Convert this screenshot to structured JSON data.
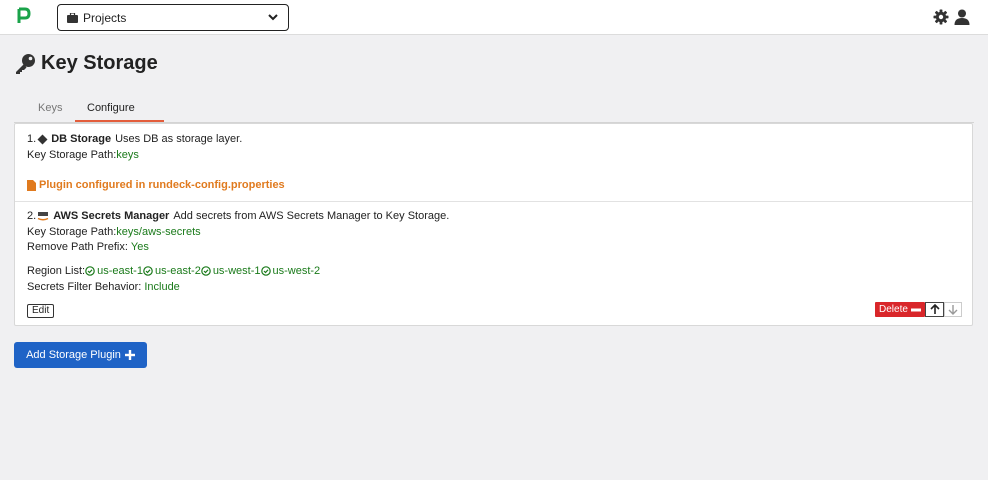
{
  "header": {
    "project_label": "Projects"
  },
  "page": {
    "title": "Key Storage"
  },
  "tabs": [
    {
      "label": "Keys"
    },
    {
      "label": "Configure"
    }
  ],
  "plugins": [
    {
      "index": "1.",
      "name": "DB Storage",
      "description": "Uses DB as storage layer.",
      "path_label": "Key Storage Path:",
      "path_value": "keys",
      "note": "Plugin configured in rundeck-config.properties"
    },
    {
      "index": "2.",
      "name": "AWS Secrets Manager",
      "description": "Add secrets from AWS Secrets Manager to Key Storage.",
      "path_label": "Key Storage Path:",
      "path_value": "keys/aws-secrets",
      "prefix_label": "Remove Path Prefix: ",
      "prefix_value": "Yes",
      "region_label": "Region List:",
      "regions": [
        "us-east-1",
        "us-east-2",
        "us-west-1",
        "us-west-2"
      ],
      "filter_label": "Secrets Filter Behavior: ",
      "filter_value": "Include",
      "edit_label": "Edit",
      "delete_label": "Delete"
    }
  ],
  "actions": {
    "add_label": "Add Storage Plugin"
  },
  "colors": {
    "accent_green": "#1a7a1a",
    "warning_orange": "#e07a1e",
    "danger_red": "#d9262a",
    "primary_blue": "#1f63c6",
    "tab_underline": "#e35d3c"
  }
}
